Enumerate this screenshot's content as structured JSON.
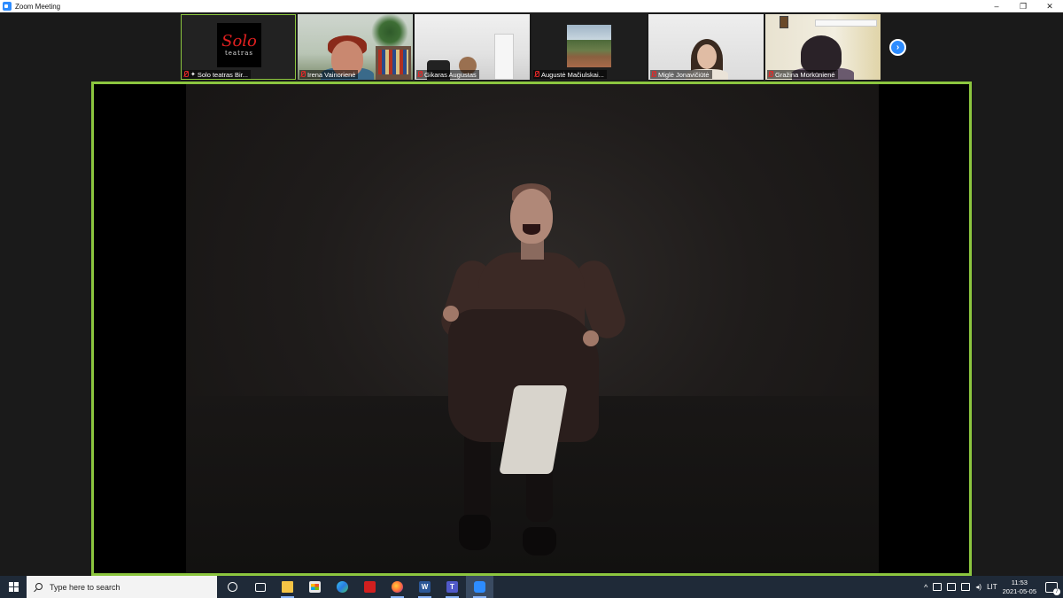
{
  "window": {
    "title": "Zoom Meeting",
    "controls": {
      "minimize": "–",
      "restore": "❐",
      "close": "✕"
    }
  },
  "participants": [
    {
      "name": "Solo teatras  Bir...",
      "muted": true,
      "pinned": true,
      "active": true,
      "logo_big": "Solo",
      "logo_small": "teatras"
    },
    {
      "name": "Irena Vainorienė",
      "muted": true
    },
    {
      "name": "Gikaras Augustas",
      "muted": true
    },
    {
      "name": "Augustė Mačiulskai...",
      "muted": true
    },
    {
      "name": "Miglė Jonavičiūtė",
      "muted": true
    },
    {
      "name": "Gražina Morkūnienė",
      "muted": true
    }
  ],
  "thumbnail_nav": {
    "next_glyph": "›"
  },
  "colors": {
    "active_speaker_border": "#8cc63f",
    "zoom_blue": "#2d8cff",
    "muted_red": "#e02828",
    "taskbar_bg": "#1f2a38"
  },
  "taskbar": {
    "search_placeholder": "Type here to search",
    "apps": [
      {
        "name": "cortana-icon",
        "label": ""
      },
      {
        "name": "task-view-icon",
        "label": ""
      },
      {
        "name": "file-explorer-icon",
        "label": ""
      },
      {
        "name": "microsoft-store-icon",
        "label": ""
      },
      {
        "name": "edge-icon",
        "label": ""
      },
      {
        "name": "acrobat-icon",
        "label": ""
      },
      {
        "name": "firefox-icon",
        "label": ""
      },
      {
        "name": "word-icon",
        "label": "W"
      },
      {
        "name": "teams-icon",
        "label": "T"
      },
      {
        "name": "zoom-icon",
        "label": ""
      }
    ],
    "tray": {
      "language": "LIT",
      "time": "11:53",
      "date": "2021-05-05",
      "notifications": "7"
    }
  }
}
